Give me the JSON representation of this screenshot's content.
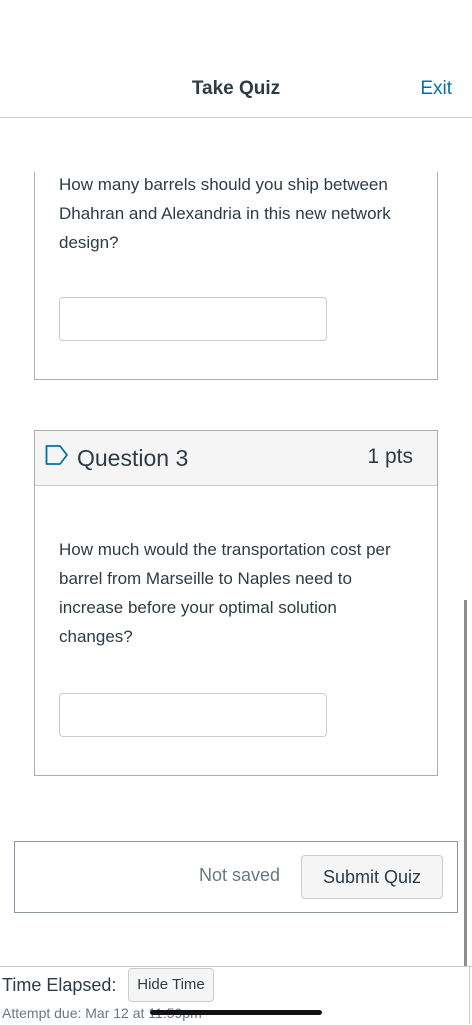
{
  "header": {
    "title": "Take Quiz",
    "exit_label": "Exit"
  },
  "question2": {
    "text": "How many barrels should you ship between Dhahran and Alexandria in this new network design?",
    "answer_value": ""
  },
  "question3": {
    "title": "Question 3",
    "points": "1 pts",
    "text": "How much would the transportation cost per barrel from Marseille to Naples need to increase before your optimal solution changes?",
    "answer_value": ""
  },
  "submit": {
    "status": "Not saved",
    "button_label": "Submit Quiz"
  },
  "timer": {
    "label": "Time Elapsed:",
    "hide_label": "Hide Time",
    "attempt_due": "Attempt due: Mar 12 at 11:59pm"
  },
  "colors": {
    "link": "#0770a3",
    "text": "#2d3b45",
    "flag": "#0770a3"
  }
}
